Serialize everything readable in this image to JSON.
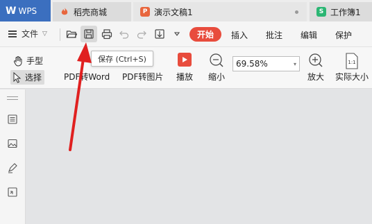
{
  "tabs": {
    "app": {
      "logo": "W",
      "label": "WPS"
    },
    "items": [
      {
        "label": "稻壳商城",
        "icon": "daoke-flame-icon"
      },
      {
        "label": "演示文稿1",
        "icon": "presentation-icon"
      },
      {
        "label": "工作簿1",
        "icon": "spreadsheet-icon"
      }
    ]
  },
  "menu": {
    "file_label": "文件",
    "tabs": [
      "开始",
      "插入",
      "批注",
      "编辑",
      "保护"
    ],
    "active_tab": "开始",
    "quick_access": [
      "open-folder-icon",
      "save-icon",
      "print-icon",
      "undo-icon",
      "redo-icon",
      "export-icon",
      "more-icon"
    ]
  },
  "ribbon": {
    "hand_tool": "手型",
    "select_tool": "选择",
    "pdf_to_word": "PDF转Word",
    "pdf_to_image": "PDF转图片",
    "play": "播放",
    "zoom_out": "缩小",
    "zoom_value": "69.58%",
    "zoom_in": "放大",
    "actual_size": "实际大小",
    "actual_size_icon_text": "1:1"
  },
  "tooltip": {
    "text": "保存 (Ctrl+S)"
  },
  "sidebar": {
    "icons": [
      "outline-icon",
      "thumbnail-icon",
      "annotation-icon",
      "attachment-icon"
    ]
  },
  "colors": {
    "wps_tab": "#3b6fbf",
    "accent_red": "#e84c3d",
    "annotation_arrow": "#e02020"
  }
}
